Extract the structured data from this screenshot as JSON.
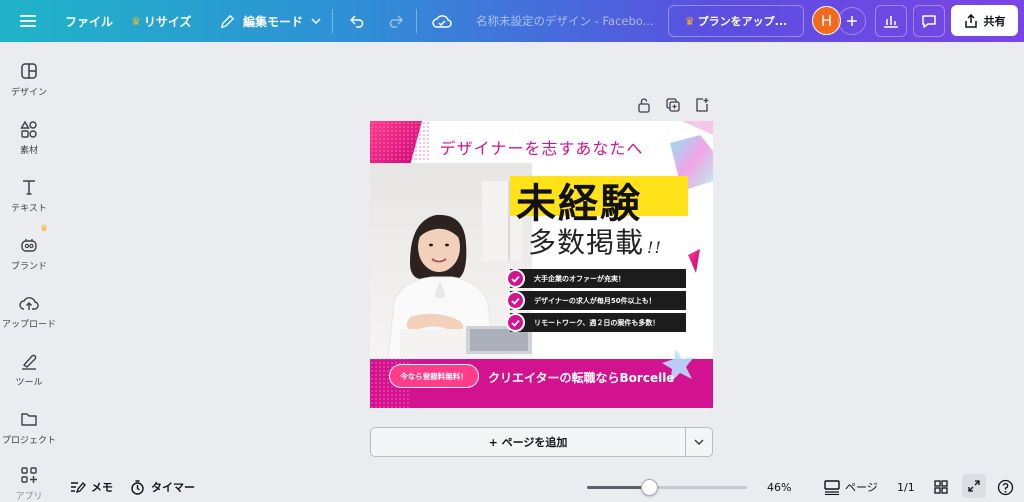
{
  "topbar": {
    "file_label": "ファイル",
    "resize_label": "リサイズ",
    "edit_mode_label": "編集モード",
    "design_title": "名称未設定のデザイン - Facebo...",
    "upgrade_label": "プランをアップ...",
    "avatar_initial": "H",
    "share_label": "共有"
  },
  "sidebar": {
    "items": [
      {
        "label": "デザイン",
        "icon": "layout-icon"
      },
      {
        "label": "素材",
        "icon": "elements-icon"
      },
      {
        "label": "テキスト",
        "icon": "text-icon"
      },
      {
        "label": "ブランド",
        "icon": "brand-icon"
      },
      {
        "label": "アップロード",
        "icon": "upload-icon"
      },
      {
        "label": "ツール",
        "icon": "tools-icon"
      },
      {
        "label": "プロジェクト",
        "icon": "folder-icon"
      },
      {
        "label": "アプリ",
        "icon": "apps-icon"
      }
    ]
  },
  "poster": {
    "heading": "デザイナーを志すあなたへ",
    "headline_main": "未経験",
    "headline_sub": "多数掲載",
    "headline_excl": "!!",
    "checks": [
      "大手企業のオファーが充実！",
      "デザイナーの求人が毎月50件以上も！",
      "リモートワーク、週２日の案件も多数！"
    ],
    "badge": "今なら登録料無料！",
    "footer": "クリエイターの転職ならBorcelle"
  },
  "canvas": {
    "add_page_label": "+ ページを追加"
  },
  "bottombar": {
    "notes_label": "メモ",
    "timer_label": "タイマー",
    "zoom_percent": "46%",
    "zoom_value": 46,
    "pages_label": "ページ",
    "page_counter": "1/1"
  },
  "colors": {
    "accent_pink": "#d3128f",
    "headline_yellow": "#ffe21a",
    "avatar_orange": "#f26a1b"
  }
}
